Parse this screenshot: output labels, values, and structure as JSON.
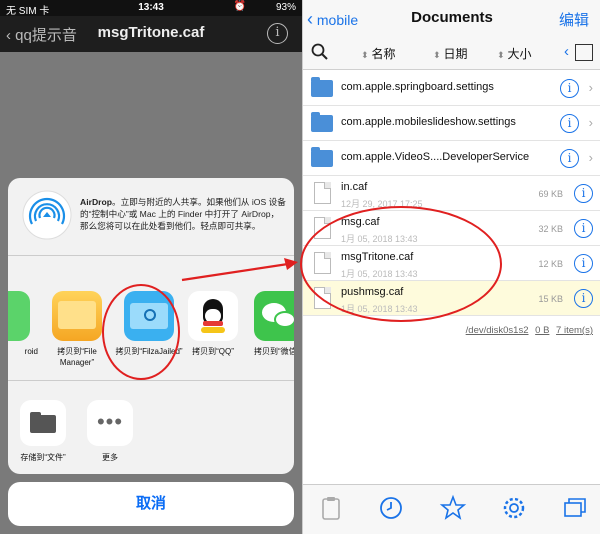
{
  "left": {
    "status": {
      "carrier": "无 SIM 卡",
      "time": "13:43",
      "battery": "93%"
    },
    "nav": {
      "back_label": "qq提示音",
      "title": "msgTritone.caf",
      "info": "i"
    },
    "airdrop": {
      "title": "AirDrop",
      "text": "。立即与附近的人共享。如果他们从 iOS 设备的“控制中心”或 Mac 上的 Finder 中打开了 AirDrop，那么您将可以在此处看到他们。轻点即可共享。"
    },
    "apps": [
      {
        "label": "roid",
        "name": "partial-app"
      },
      {
        "label": "拷贝到“File Manager”",
        "name": "file-manager"
      },
      {
        "label": "拷贝到“FilzaJailed”",
        "name": "filza"
      },
      {
        "label": "拷贝到“QQ”",
        "name": "qq"
      },
      {
        "label": "拷贝到“微信",
        "name": "wechat"
      }
    ],
    "actions": [
      {
        "label": "存储到“文件”"
      },
      {
        "label": "更多"
      }
    ],
    "cancel_label": "取消"
  },
  "right": {
    "nav": {
      "back_label": "mobile",
      "title": "Documents",
      "edit_label": "编辑"
    },
    "sort": {
      "name": "名称",
      "date": "日期",
      "size": "大小"
    },
    "rows": [
      {
        "name": "com.apple.springboard.settings",
        "type": "folder"
      },
      {
        "name": "com.apple.mobileslideshow.settings",
        "type": "folder"
      },
      {
        "name": "com.apple.VideoS....DeveloperService",
        "type": "folder"
      },
      {
        "name": "in.caf",
        "date": "12月 29, 2017 17:25",
        "size": "69 KB",
        "type": "file"
      },
      {
        "name": "msg.caf",
        "date": "1月 05, 2018 13:43",
        "size": "32 KB",
        "type": "file"
      },
      {
        "name": "msgTritone.caf",
        "date": "1月 05, 2018 13:43",
        "size": "12 KB",
        "type": "file"
      },
      {
        "name": "pushmsg.caf",
        "date": "1月 05, 2018 13:43",
        "size": "15 KB",
        "type": "file",
        "selected": true
      }
    ],
    "footer": {
      "disk": "/dev/disk0s1s2",
      "bytes": "0 B",
      "items": "7 item(s)"
    }
  },
  "colors": {
    "accent": "#1a73e8",
    "annotation": "#e02020",
    "selected_row": "#fefbdc"
  }
}
